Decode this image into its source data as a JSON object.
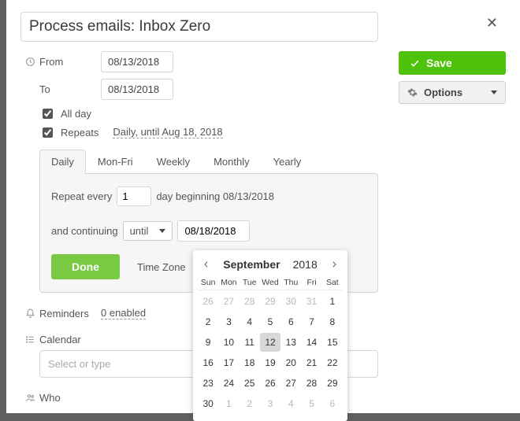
{
  "title": "Process emails: Inbox Zero",
  "dates": {
    "from_label": "From",
    "from": "08/13/2018",
    "to_label": "To",
    "to": "08/13/2018"
  },
  "allday": {
    "label": "All day",
    "checked": true
  },
  "repeats": {
    "label": "Repeats",
    "summary": "Daily, until Aug 18, 2018",
    "checked": true
  },
  "repeat_panel": {
    "tabs": [
      "Daily",
      "Mon-Fri",
      "Weekly",
      "Monthly",
      "Yearly"
    ],
    "active_tab": 0,
    "line1_pre": "Repeat every",
    "every_n": "1",
    "line1_post": "day beginning 08/13/2018",
    "line2_pre": "and continuing",
    "until_mode": "until",
    "until_date": "08/18/2018",
    "done": "Done",
    "timezone_label": "Time Zone"
  },
  "buttons": {
    "save": "Save",
    "options": "Options"
  },
  "reminders": {
    "label": "Reminders",
    "count": "0 enabled"
  },
  "calendar": {
    "label": "Calendar",
    "placeholder": "Select or type"
  },
  "who": {
    "label": "Who"
  },
  "datepicker": {
    "month": "September",
    "year": "2018",
    "weekdays": [
      "Sun",
      "Mon",
      "Tue",
      "Wed",
      "Thu",
      "Fri",
      "Sat"
    ],
    "rows": [
      [
        {
          "d": 26,
          "o": 1
        },
        {
          "d": 27,
          "o": 1
        },
        {
          "d": 28,
          "o": 1
        },
        {
          "d": 29,
          "o": 1
        },
        {
          "d": 30,
          "o": 1
        },
        {
          "d": 31,
          "o": 1
        },
        {
          "d": 1
        }
      ],
      [
        {
          "d": 2
        },
        {
          "d": 3
        },
        {
          "d": 4
        },
        {
          "d": 5
        },
        {
          "d": 6
        },
        {
          "d": 7
        },
        {
          "d": 8
        }
      ],
      [
        {
          "d": 9
        },
        {
          "d": 10
        },
        {
          "d": 11
        },
        {
          "d": 12,
          "sel": 1
        },
        {
          "d": 13
        },
        {
          "d": 14
        },
        {
          "d": 15
        }
      ],
      [
        {
          "d": 16
        },
        {
          "d": 17
        },
        {
          "d": 18
        },
        {
          "d": 19
        },
        {
          "d": 20
        },
        {
          "d": 21
        },
        {
          "d": 22
        }
      ],
      [
        {
          "d": 23
        },
        {
          "d": 24
        },
        {
          "d": 25
        },
        {
          "d": 26
        },
        {
          "d": 27
        },
        {
          "d": 28
        },
        {
          "d": 29
        }
      ],
      [
        {
          "d": 30
        },
        {
          "d": 1,
          "o": 1
        },
        {
          "d": 2,
          "o": 1
        },
        {
          "d": 3,
          "o": 1
        },
        {
          "d": 4,
          "o": 1
        },
        {
          "d": 5,
          "o": 1
        },
        {
          "d": 6,
          "o": 1
        }
      ]
    ]
  }
}
